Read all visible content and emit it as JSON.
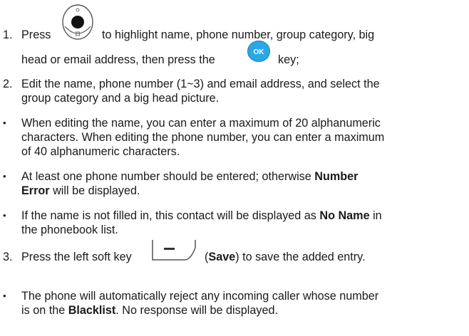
{
  "step1": {
    "number": "1.",
    "before_nav": "Press",
    "after_nav": "to highlight name, phone number, group category, big",
    "line2_before_ok": "head or email address, then press the",
    "ok_key_label": "OK",
    "line2_after_ok": "key;"
  },
  "step2": {
    "number": "2.",
    "line1": "Edit the name, phone number (1~3) and email address, and select the",
    "line2": "group category and a big head picture."
  },
  "bullet1": {
    "line1": "When editing the name, you can enter a maximum of 20 alphanumeric",
    "line2": "characters. When editing the phone number, you can enter a maximum",
    "line3": "of 40 alphanumeric characters."
  },
  "bullet2": {
    "line1_text": "At least one phone number should be entered; otherwise",
    "line1_bold": "Number",
    "line2_bold": "Error",
    "line2_text": "will be displayed."
  },
  "bullet3": {
    "line1_text": "If the name is not filled in, this contact will be displayed as",
    "line1_bold": "No Name",
    "line1_end": "in",
    "line2": "the phonebook list."
  },
  "step3": {
    "number": "3.",
    "before_key": "Press the left soft key",
    "open_paren": "(",
    "bold": "Save",
    "after": ") to save the added entry."
  },
  "bullet4": {
    "line1": "The phone will automatically reject any incoming caller whose number",
    "line2_before": "is on the",
    "line2_bold": "Blacklist",
    "line2_after": ". No response will be displayed."
  },
  "bullet_glyph": "•"
}
